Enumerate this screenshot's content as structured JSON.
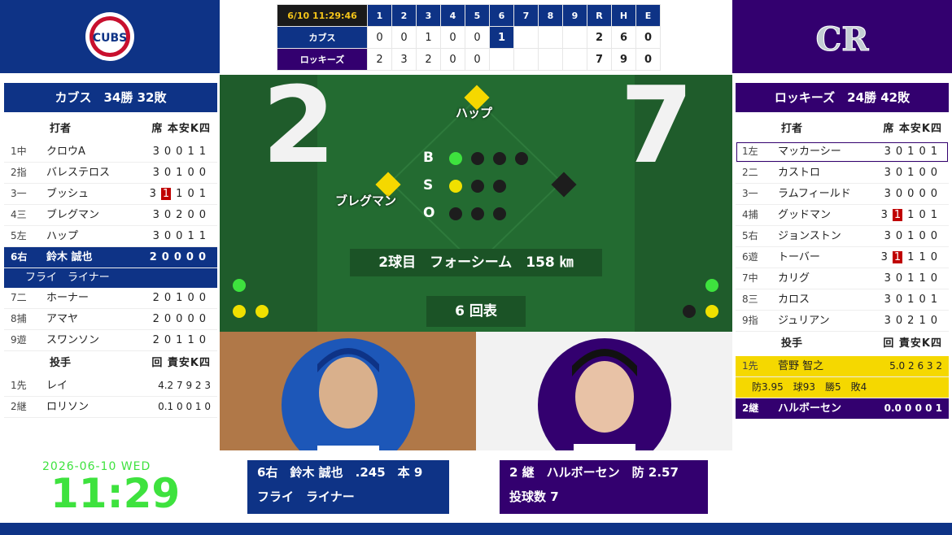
{
  "colors": {
    "cubs_blue": "#0e3386",
    "rockies_purple": "#33006f",
    "field_green": "#236b31",
    "clock_green": "#3ee23e",
    "highlight_red": "#c00000",
    "pitcher_yellow": "#f5d800"
  },
  "logos": {
    "home_text": "CUBS",
    "away_text": "CR"
  },
  "scoreboard": {
    "time": "6/10 11:29:46",
    "innings": [
      "1",
      "2",
      "3",
      "4",
      "5",
      "6",
      "7",
      "8",
      "9"
    ],
    "totals_headers": [
      "R",
      "H",
      "E"
    ],
    "teams": [
      {
        "name": "カブス",
        "innings": [
          "0",
          "0",
          "1",
          "0",
          "0",
          "1",
          "",
          "",
          ""
        ],
        "R": "2",
        "H": "6",
        "E": "0"
      },
      {
        "name": "ロッキーズ",
        "innings": [
          "2",
          "3",
          "2",
          "0",
          "0",
          "",
          "",
          "",
          ""
        ],
        "R": "7",
        "H": "9",
        "E": "0"
      }
    ]
  },
  "left_panel": {
    "title": "カブス　34勝 32敗",
    "batters_header": "打者",
    "batters_cols": "席 本安K四",
    "batters": [
      {
        "ord": "1中",
        "name": "クロウA",
        "stats": "30011"
      },
      {
        "ord": "2指",
        "name": "バレステロス",
        "stats": "30100"
      },
      {
        "ord": "3一",
        "name": "ブッシュ",
        "pre": "3",
        "hl": "1",
        "post": "101"
      },
      {
        "ord": "4三",
        "name": "ブレグマン",
        "stats": "30200"
      },
      {
        "ord": "5左",
        "name": "ハップ",
        "stats": "30011"
      },
      {
        "ord": "6右",
        "name": "鈴木 誠也",
        "stats": "20000"
      },
      {
        "ord": "7二",
        "name": "ホーナー",
        "stats": "20100"
      },
      {
        "ord": "8捕",
        "name": "アマヤ",
        "stats": "20000"
      },
      {
        "ord": "9遊",
        "name": "スワンソン",
        "stats": "20110"
      }
    ],
    "active_sub": "フライ　ライナー",
    "pitchers_header": "投手",
    "pitchers_cols": "回 責安K四",
    "pitchers": [
      {
        "ord": "1先",
        "name": "レイ",
        "stats": "4.2 7 9 2 3"
      },
      {
        "ord": "2継",
        "name": "ロリソン",
        "stats": "0.1 0 0 1 0"
      }
    ]
  },
  "right_panel": {
    "title": "ロッキーズ　24勝 42敗",
    "batters_header": "打者",
    "batters_cols": "席 本安K四",
    "batters": [
      {
        "ord": "1左",
        "name": "マッカーシー",
        "stats": "30101"
      },
      {
        "ord": "2二",
        "name": "カストロ",
        "stats": "30100"
      },
      {
        "ord": "3一",
        "name": "ラムフィールド",
        "stats": "30000"
      },
      {
        "ord": "4捕",
        "name": "グッドマン",
        "pre": "3",
        "hl": "1",
        "post": "101"
      },
      {
        "ord": "5右",
        "name": "ジョンストン",
        "stats": "30100"
      },
      {
        "ord": "6遊",
        "name": "トーバー",
        "pre": "3",
        "hl": "1",
        "post": "110"
      },
      {
        "ord": "7中",
        "name": "カリグ",
        "stats": "30110"
      },
      {
        "ord": "8三",
        "name": "カロス",
        "stats": "30101"
      },
      {
        "ord": "9指",
        "name": "ジュリアン",
        "stats": "30210"
      }
    ],
    "pitchers_header": "投手",
    "pitchers_cols": "回 責安K四",
    "pitchers": [
      {
        "ord": "1先",
        "name": "菅野 智之",
        "stats": "5.0 2 6 3 2",
        "sub": "防3.95　球93　勝5　敗4"
      },
      {
        "ord": "2継",
        "name": "ハルボーセン",
        "stats": "0.0 0 0 0 1"
      }
    ]
  },
  "field": {
    "score_home": "2",
    "score_away": "7",
    "runner_second": "ハップ",
    "runner_third": "ブレグマン",
    "labels": {
      "b": "B",
      "s": "S",
      "o": "O"
    },
    "count": {
      "balls": 1,
      "strikes": 1,
      "outs": 0
    },
    "pitch_info": "2球目　フォーシーム　158 ㎞",
    "inning": "6 回表"
  },
  "cards": {
    "batter_line1": "6右　鈴木 誠也　.245　本 9",
    "batter_line2": "フライ　ライナー",
    "pitcher_line1": "2 継　ハルボーセン　防 2.57",
    "pitcher_line2": "投球数 7"
  },
  "clock": {
    "date": "2026-06-10 WED",
    "time": "11:29"
  }
}
